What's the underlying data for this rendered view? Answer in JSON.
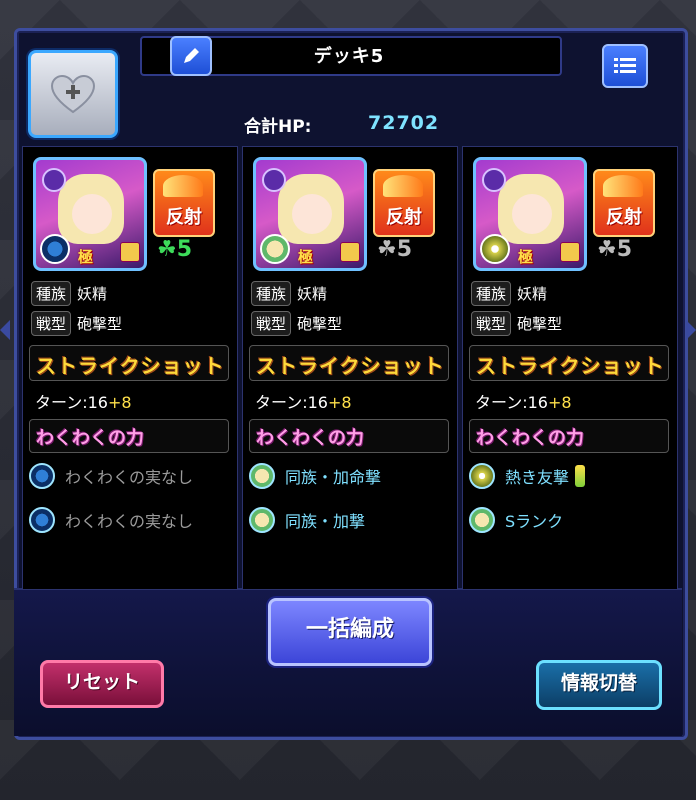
{
  "deck": {
    "title": "デッキ5"
  },
  "hp": {
    "label": "合計HP:",
    "value": "72702"
  },
  "icons": {
    "edit": "pencil-icon",
    "menu": "list-menu-icon",
    "heart": "heart-plus-icon"
  },
  "columns": [
    {
      "reflect_label": "反射",
      "luck_symbol": "☘",
      "luck_value": "5",
      "luck_color": "#3ddb5a",
      "tribe_label": "種族",
      "tribe_value": "妖精",
      "type_label": "戦型",
      "type_value": "砲撃型",
      "strike_shot": "ストライクショット",
      "turn_text": "ターン:16",
      "turn_plus": "+8",
      "ability": "わくわくの力",
      "fruits": [
        {
          "icon": "water-orb-icon",
          "label": "わくわくの実なし",
          "dim": true
        },
        {
          "icon": "water-orb-icon",
          "label": "わくわくの実なし",
          "dim": true
        }
      ]
    },
    {
      "reflect_label": "反射",
      "luck_symbol": "☘",
      "luck_value": "5",
      "luck_color": "#bbbbbb",
      "tribe_label": "種族",
      "tribe_value": "妖精",
      "type_label": "戦型",
      "type_value": "砲撃型",
      "strike_shot": "ストライクショット",
      "turn_text": "ターン:16",
      "turn_plus": "+8",
      "ability": "わくわくの力",
      "fruits": [
        {
          "icon": "fruit-face-icon",
          "label": "同族・加命撃",
          "dim": false
        },
        {
          "icon": "fruit-face-icon",
          "label": "同族・加撃",
          "dim": false
        }
      ]
    },
    {
      "reflect_label": "反射",
      "luck_symbol": "☘",
      "luck_value": "5",
      "luck_color": "#bbbbbb",
      "tribe_label": "種族",
      "tribe_value": "妖精",
      "type_label": "戦型",
      "type_value": "砲撃型",
      "strike_shot": "ストライクショット",
      "turn_text": "ターン:16",
      "turn_plus": "+8",
      "ability": "わくわくの力",
      "fruits": [
        {
          "icon": "star-fruit-icon",
          "label": "熱き友撃",
          "dim": false
        },
        {
          "icon": "fruit-face-icon",
          "label": "Sランク",
          "dim": false
        }
      ]
    }
  ],
  "buttons": {
    "bulk": "一括編成",
    "reset": "リセット",
    "switch": "情報切替"
  }
}
